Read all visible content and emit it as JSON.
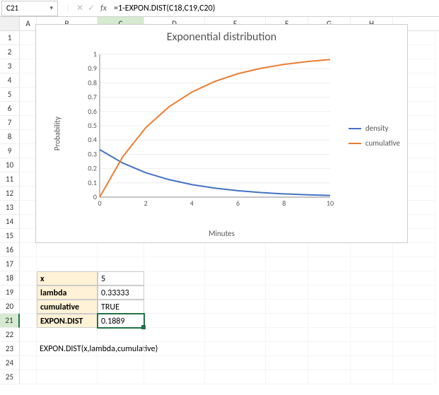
{
  "formula_bar": {
    "cell_ref": "C21",
    "formula": "=1-EXPON.DIST(C18,C19,C20)",
    "fx": "fx"
  },
  "columns": [
    "A",
    "B",
    "C",
    "D",
    "E",
    "F",
    "G",
    "H"
  ],
  "rows": [
    "1",
    "2",
    "3",
    "4",
    "5",
    "6",
    "7",
    "8",
    "9",
    "10",
    "11",
    "12",
    "13",
    "14",
    "15",
    "16",
    "17",
    "18",
    "19",
    "20",
    "21",
    "22",
    "23",
    "24",
    "25"
  ],
  "table": {
    "r18_label": "x",
    "r18_val": "5",
    "r19_label": "lambda",
    "r19_val": "0.33333",
    "r20_label": "cumulative",
    "r20_val": "TRUE",
    "r21_label": "EXPON.DIST",
    "r21_val": "0.1889"
  },
  "note": "EXPON.DIST(x,lambda,cumulative)",
  "chart": {
    "title": "Exponential distribution",
    "xlabel": "Minutes",
    "ylabel": "Probability",
    "legend": {
      "density": "density",
      "cumulative": "cumulative"
    },
    "colors": {
      "density": "#4472C4",
      "cumulative": "#ED7D31"
    }
  },
  "chart_data": {
    "type": "line",
    "x": [
      0,
      1,
      2,
      3,
      4,
      5,
      6,
      7,
      8,
      9,
      10
    ],
    "xticks": [
      0,
      2,
      4,
      6,
      8,
      10
    ],
    "yticks": [
      0,
      0.1,
      0.2,
      0.3,
      0.4,
      0.5,
      0.6,
      0.7,
      0.8,
      0.9,
      1
    ],
    "series": [
      {
        "name": "density",
        "values": [
          0.333,
          0.239,
          0.171,
          0.123,
          0.088,
          0.063,
          0.045,
          0.032,
          0.023,
          0.017,
          0.012
        ]
      },
      {
        "name": "cumulative",
        "values": [
          0.0,
          0.283,
          0.487,
          0.632,
          0.736,
          0.811,
          0.865,
          0.903,
          0.93,
          0.95,
          0.964
        ]
      }
    ],
    "ylim": [
      0,
      1
    ],
    "xlim": [
      0,
      10
    ]
  }
}
